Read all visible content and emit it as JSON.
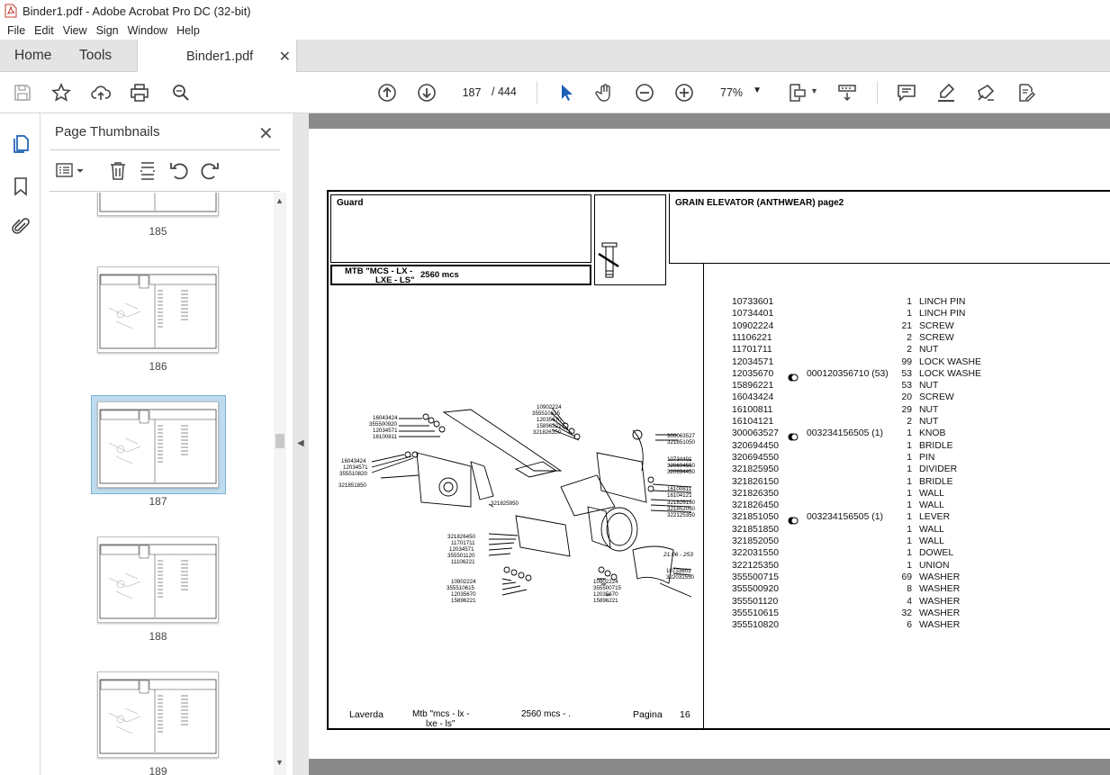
{
  "window": {
    "title": "Binder1.pdf - Adobe Acrobat Pro DC (32-bit)"
  },
  "menu": [
    "File",
    "Edit",
    "View",
    "Sign",
    "Window",
    "Help"
  ],
  "tabs": {
    "home": "Home",
    "tools": "Tools",
    "document": "Binder1.pdf"
  },
  "toolbar": {
    "page_current": "187",
    "page_total": "/ 444",
    "zoom": "77%"
  },
  "thumbnails": {
    "title": "Page Thumbnails",
    "pages": [
      "185",
      "186",
      "187",
      "188",
      "189"
    ],
    "selected": "187"
  },
  "document": {
    "header_left": "Guard",
    "header_right": "GRAIN ELEVATOR (ANTHWEAR)  page2",
    "model_line1": "MTB \"MCS - LX -",
    "model_line2": "LXE - LS\"",
    "model_mcs": "2560  mcs",
    "footer": {
      "brand": "Laverda",
      "model1": "Mtb \"mcs - lx -",
      "model2": "lxe - ls\"",
      "mcs": "2560  mcs - .",
      "pagina": "Pagina",
      "page": "16"
    },
    "diagram_date": "21.06 - 253",
    "parts": [
      {
        "code": "10733601",
        "ref": "",
        "qty": "1",
        "name": "LINCH PIN"
      },
      {
        "code": "10734401",
        "ref": "",
        "qty": "1",
        "name": "LINCH PIN"
      },
      {
        "code": "10902224",
        "ref": "",
        "qty": "21",
        "name": "SCREW"
      },
      {
        "code": "11106221",
        "ref": "",
        "qty": "2",
        "name": "SCREW"
      },
      {
        "code": "11701711",
        "ref": "",
        "qty": "2",
        "name": "NUT"
      },
      {
        "code": "12034571",
        "ref": "",
        "qty": "99",
        "name": "LOCK WASHE"
      },
      {
        "code": "12035670",
        "ref": "000120356710  (53)",
        "qty": "53",
        "name": "LOCK WASHE"
      },
      {
        "code": "15896221",
        "ref": "",
        "qty": "53",
        "name": "NUT"
      },
      {
        "code": "16043424",
        "ref": "",
        "qty": "20",
        "name": "SCREW"
      },
      {
        "code": "16100811",
        "ref": "",
        "qty": "29",
        "name": "NUT"
      },
      {
        "code": "16104121",
        "ref": "",
        "qty": "2",
        "name": "NUT"
      },
      {
        "code": "300063527",
        "ref": "003234156505  (1)",
        "qty": "1",
        "name": "KNOB"
      },
      {
        "code": "320694450",
        "ref": "",
        "qty": "1",
        "name": "BRIDLE"
      },
      {
        "code": "320694550",
        "ref": "",
        "qty": "1",
        "name": "PIN"
      },
      {
        "code": "321825950",
        "ref": "",
        "qty": "1",
        "name": "DIVIDER"
      },
      {
        "code": "321826150",
        "ref": "",
        "qty": "1",
        "name": "BRIDLE"
      },
      {
        "code": "321826350",
        "ref": "",
        "qty": "1",
        "name": "WALL"
      },
      {
        "code": "321826450",
        "ref": "",
        "qty": "1",
        "name": "WALL"
      },
      {
        "code": "321851050",
        "ref": "003234156505  (1)",
        "qty": "1",
        "name": "LEVER"
      },
      {
        "code": "321851850",
        "ref": "",
        "qty": "1",
        "name": "WALL"
      },
      {
        "code": "321852050",
        "ref": "",
        "qty": "1",
        "name": "WALL"
      },
      {
        "code": "322031550",
        "ref": "",
        "qty": "1",
        "name": "DOWEL"
      },
      {
        "code": "322125350",
        "ref": "",
        "qty": "1",
        "name": "UNION"
      },
      {
        "code": "355500715",
        "ref": "",
        "qty": "69",
        "name": "WASHER"
      },
      {
        "code": "355500920",
        "ref": "",
        "qty": "8",
        "name": "WASHER"
      },
      {
        "code": "355501120",
        "ref": "",
        "qty": "4",
        "name": "WASHER"
      },
      {
        "code": "355510615",
        "ref": "",
        "qty": "32",
        "name": "WASHER"
      },
      {
        "code": "355510820",
        "ref": "",
        "qty": "6",
        "name": "WASHER"
      }
    ],
    "callouts_left": [
      "16043424",
      "355500920",
      "12034571",
      "16100811",
      "16043424",
      "12034571",
      "355510820",
      "321851850"
    ],
    "callouts_top": [
      "10902224",
      "355510615",
      "12035670",
      "15896221",
      "321826350"
    ],
    "callouts_right": [
      "300063527",
      "321851050",
      "10734401",
      "320694550",
      "320694450",
      "16100811",
      "16104121",
      "321826150",
      "321852050",
      "322125350"
    ],
    "callouts_mid": "321825950",
    "callouts_lower_left": [
      "321826450",
      "11701711",
      "12034571",
      "355501120",
      "11106221"
    ],
    "callouts_bottom_left": [
      "10902224",
      "355510615",
      "12035670",
      "15896221"
    ],
    "callouts_bottom_mid": [
      "10902224",
      "355500715",
      "12035670",
      "15896221"
    ],
    "callouts_bottom_right": [
      "10733601",
      "322031550"
    ]
  }
}
